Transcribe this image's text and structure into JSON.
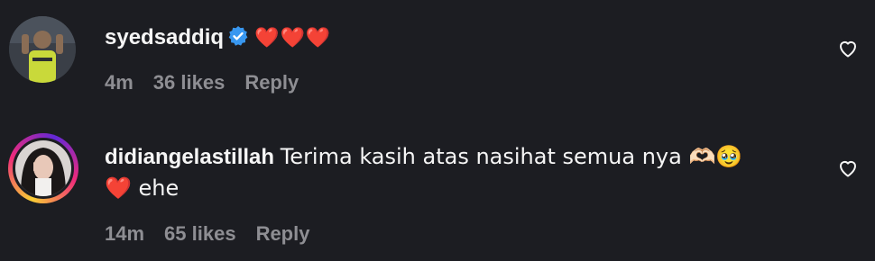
{
  "comments": [
    {
      "username": "syedsaddiq",
      "verified": true,
      "text": "❤️❤️❤️",
      "time": "4m",
      "likes": "36 likes",
      "reply": "Reply",
      "avatar_icon": "profile-photo"
    },
    {
      "username": "didiangelastillah",
      "verified": false,
      "text_line1": "Terima kasih atas nasihat semua nya 🫶🏻🥹",
      "text_line2": "❤️ ehe",
      "time": "14m",
      "likes": "65 likes",
      "reply": "Reply",
      "avatar_icon": "profile-photo-story-ring"
    }
  ],
  "colors": {
    "background": "#1c1d22",
    "text": "#f5f5f5",
    "meta": "#8e8e93",
    "verified": "#3897f0",
    "heart": "#ee2a2a"
  }
}
